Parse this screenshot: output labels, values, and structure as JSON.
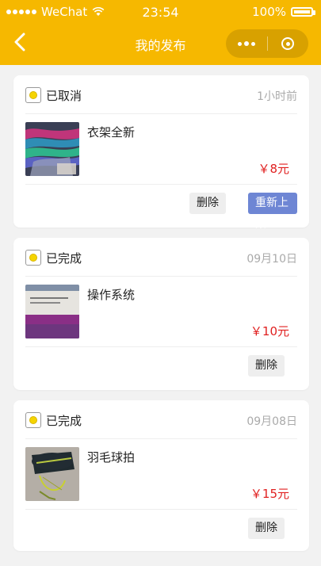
{
  "status_bar": {
    "carrier": "WeChat",
    "time": "23:54",
    "battery": "100%"
  },
  "nav": {
    "title": "我的发布"
  },
  "cards": [
    {
      "status": "已取消",
      "time": "1小时前",
      "title": "衣架全新",
      "price": "￥8元",
      "buttons": [
        "删除",
        "重新上架"
      ]
    },
    {
      "status": "已完成",
      "time": "09月10日",
      "title": "操作系统",
      "price": "￥10元",
      "buttons": [
        "删除"
      ]
    },
    {
      "status": "已完成",
      "time": "09月08日",
      "title": "羽毛球拍",
      "price": "￥15元",
      "buttons": [
        "删除"
      ]
    }
  ],
  "icons": {
    "back": "chevron-left-icon",
    "more": "more-dots-icon",
    "close": "circle-close-icon",
    "status": "status-ball-icon"
  },
  "colors": {
    "accent": "#f6b800",
    "price": "#e02020",
    "primary_button": "#6e86d4"
  }
}
